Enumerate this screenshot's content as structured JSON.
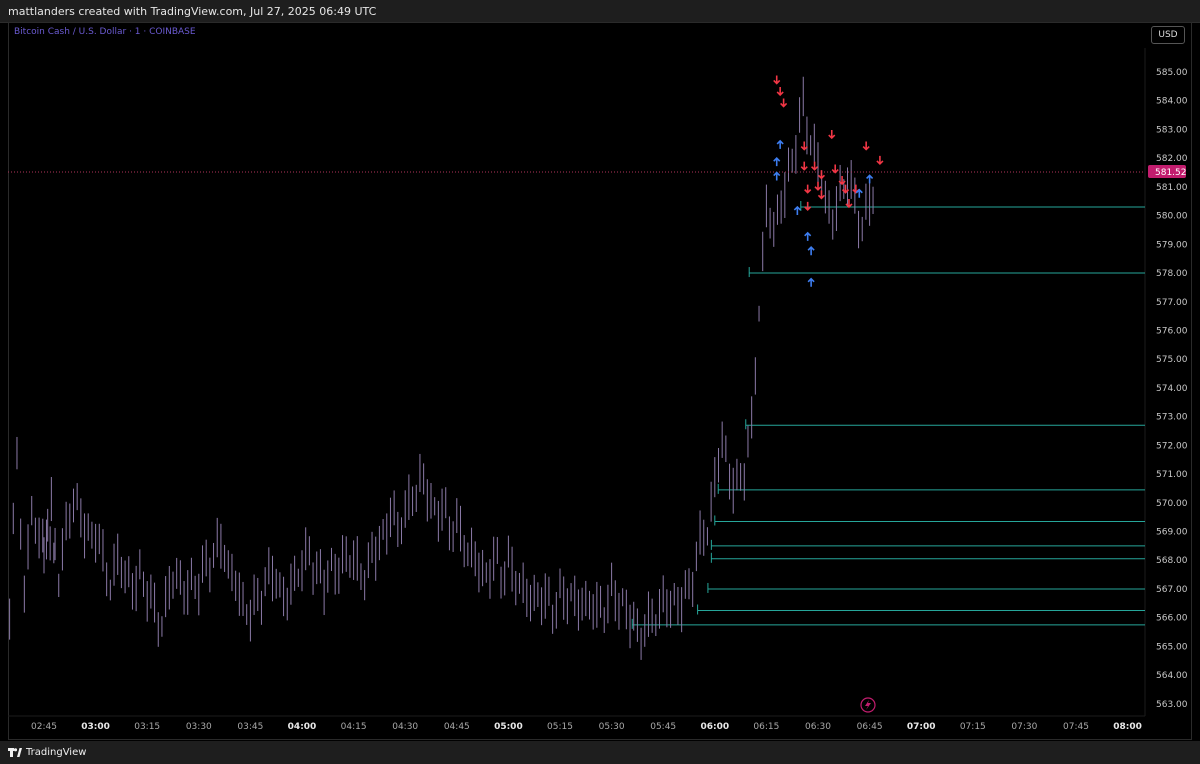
{
  "header": {
    "credit": "mattlanders created with TradingView.com, Jul 27, 2025 06:49 UTC"
  },
  "symbol": {
    "title": "Bitcoin Cash / U.S. Dollar · 1 · COINBASE"
  },
  "currency_button": {
    "label": "USD"
  },
  "footer": {
    "logo_text": "TradingView"
  },
  "colors": {
    "candle": "#8b7aa8",
    "level_line": "#26a69a",
    "up_arrow": "#3d7df0",
    "down_arrow": "#f23645",
    "last_price_line": "#b0355a",
    "last_price_badge": "#c21d6e"
  },
  "chart_data": {
    "type": "line",
    "ylim": [
      563,
      585.5
    ],
    "y_ticks": [
      "585.00",
      "584.00",
      "583.00",
      "582.00",
      "581.00",
      "580.00",
      "579.00",
      "578.00",
      "577.00",
      "576.00",
      "575.00",
      "574.00",
      "573.00",
      "572.00",
      "571.00",
      "570.00",
      "569.00",
      "568.00",
      "567.00",
      "566.00",
      "565.00",
      "564.00",
      "563.00"
    ],
    "x_ticks": [
      {
        "label": "02:45",
        "bold": false
      },
      {
        "label": "03:00",
        "bold": true
      },
      {
        "label": "03:15",
        "bold": false
      },
      {
        "label": "03:30",
        "bold": false
      },
      {
        "label": "03:45",
        "bold": false
      },
      {
        "label": "04:00",
        "bold": true
      },
      {
        "label": "04:15",
        "bold": false
      },
      {
        "label": "04:30",
        "bold": false
      },
      {
        "label": "04:45",
        "bold": false
      },
      {
        "label": "05:00",
        "bold": true
      },
      {
        "label": "05:15",
        "bold": false
      },
      {
        "label": "05:30",
        "bold": false
      },
      {
        "label": "05:45",
        "bold": false
      },
      {
        "label": "06:00",
        "bold": true
      },
      {
        "label": "06:15",
        "bold": false
      },
      {
        "label": "06:30",
        "bold": false
      },
      {
        "label": "06:45",
        "bold": false
      },
      {
        "label": "07:00",
        "bold": true
      },
      {
        "label": "07:15",
        "bold": false
      },
      {
        "label": "07:30",
        "bold": false
      },
      {
        "label": "07:45",
        "bold": false
      },
      {
        "label": "08:00",
        "bold": true
      }
    ],
    "last_price": {
      "value": 581.52,
      "label": "581.52"
    },
    "series": [
      {
        "time": "02:35",
        "values": [
          566.0,
          572.0,
          566.5,
          570.0,
          568.5,
          569.0,
          568.0
        ]
      },
      {
        "time": "02:45",
        "values": [
          568.5,
          569.8,
          567.5,
          569.0,
          570.2,
          569.5,
          568.8
        ]
      },
      {
        "time": "03:00",
        "values": [
          569.0,
          568.0,
          567.2,
          568.0,
          567.6,
          567.0,
          567.5
        ]
      },
      {
        "time": "03:15",
        "values": [
          567.0,
          566.2,
          565.8,
          567.0,
          567.6,
          566.8,
          567.2
        ]
      },
      {
        "time": "03:30",
        "values": [
          567.2,
          567.8,
          568.2,
          568.6,
          567.8,
          567.2,
          566.4
        ]
      },
      {
        "time": "03:45",
        "values": [
          566.2,
          566.6,
          567.2,
          567.6,
          567.0,
          566.6,
          567.4
        ]
      },
      {
        "time": "04:00",
        "values": [
          567.8,
          568.2,
          567.6,
          567.2,
          567.8,
          567.6,
          568.2
        ]
      },
      {
        "time": "04:15",
        "values": [
          568.0,
          567.4,
          567.8,
          568.4,
          568.8,
          569.6,
          569.2
        ]
      },
      {
        "time": "04:30",
        "values": [
          569.6,
          570.2,
          570.8,
          570.4,
          569.6,
          569.8,
          569.2
        ]
      },
      {
        "time": "04:45",
        "values": [
          569.2,
          568.6,
          568.2,
          567.8,
          567.4,
          568.0,
          567.6
        ]
      },
      {
        "time": "05:00",
        "values": [
          567.8,
          567.4,
          567.0,
          566.6,
          566.8,
          566.6,
          566.4
        ]
      },
      {
        "time": "05:15",
        "values": [
          566.6,
          566.8,
          566.6,
          566.4,
          566.6,
          566.2,
          566.4
        ]
      },
      {
        "time": "05:30",
        "values": [
          566.8,
          566.6,
          566.2,
          565.8,
          565.4,
          565.8,
          566.2
        ]
      },
      {
        "time": "05:45",
        "values": [
          566.4,
          566.6,
          566.4,
          566.8,
          567.4,
          568.6,
          569.2
        ]
      },
      {
        "time": "06:00",
        "values": [
          570.6,
          572.4,
          570.8,
          570.6,
          571.2,
          572.6,
          576.8
        ]
      },
      {
        "time": "06:15",
        "values": [
          580.2,
          579.6,
          580.4,
          581.4,
          582.6,
          583.8,
          582.6
        ]
      },
      {
        "time": "06:30",
        "values": [
          581.8,
          580.6,
          579.8,
          580.8,
          581.4,
          580.4,
          579.6
        ]
      },
      {
        "time": "06:45",
        "values": [
          580.6,
          580.8,
          581.2,
          581.6,
          581.5
        ]
      }
    ],
    "level_lines": [
      {
        "price": 580.3,
        "from": "06:25"
      },
      {
        "price": 578.0,
        "from": "06:10"
      },
      {
        "price": 572.7,
        "from": "06:09"
      },
      {
        "price": 570.45,
        "from": "06:01"
      },
      {
        "price": 569.35,
        "from": "06:00"
      },
      {
        "price": 568.5,
        "from": "05:59"
      },
      {
        "price": 568.05,
        "from": "05:59"
      },
      {
        "price": 567.0,
        "from": "05:58"
      },
      {
        "price": 566.25,
        "from": "05:55"
      },
      {
        "price": 565.75,
        "from": "05:36"
      }
    ],
    "signals": [
      {
        "time": "06:18",
        "price": 584.6,
        "dir": "down"
      },
      {
        "time": "06:19",
        "price": 584.2,
        "dir": "down"
      },
      {
        "time": "06:20",
        "price": 583.8,
        "dir": "down"
      },
      {
        "time": "06:19",
        "price": 582.6,
        "dir": "up"
      },
      {
        "time": "06:18",
        "price": 582.0,
        "dir": "up"
      },
      {
        "time": "06:18",
        "price": 581.5,
        "dir": "up"
      },
      {
        "time": "06:24",
        "price": 580.3,
        "dir": "up"
      },
      {
        "time": "06:26",
        "price": 582.3,
        "dir": "down"
      },
      {
        "time": "06:26",
        "price": 581.6,
        "dir": "down"
      },
      {
        "time": "06:27",
        "price": 580.8,
        "dir": "down"
      },
      {
        "time": "06:27",
        "price": 580.2,
        "dir": "down"
      },
      {
        "time": "06:27",
        "price": 579.4,
        "dir": "up"
      },
      {
        "time": "06:28",
        "price": 578.9,
        "dir": "up"
      },
      {
        "time": "06:29",
        "price": 581.6,
        "dir": "down"
      },
      {
        "time": "06:30",
        "price": 580.9,
        "dir": "down"
      },
      {
        "time": "06:31",
        "price": 581.3,
        "dir": "down"
      },
      {
        "time": "06:31",
        "price": 580.6,
        "dir": "down"
      },
      {
        "time": "06:28",
        "price": 577.8,
        "dir": "up"
      },
      {
        "time": "06:34",
        "price": 582.7,
        "dir": "down"
      },
      {
        "time": "06:35",
        "price": 581.5,
        "dir": "down"
      },
      {
        "time": "06:37",
        "price": 581.1,
        "dir": "down"
      },
      {
        "time": "06:38",
        "price": 580.8,
        "dir": "down"
      },
      {
        "time": "06:39",
        "price": 580.3,
        "dir": "down"
      },
      {
        "time": "06:41",
        "price": 580.8,
        "dir": "down"
      },
      {
        "time": "06:42",
        "price": 580.9,
        "dir": "up"
      },
      {
        "time": "06:44",
        "price": 582.3,
        "dir": "down"
      },
      {
        "time": "06:45",
        "price": 581.4,
        "dir": "up"
      },
      {
        "time": "06:48",
        "price": 581.8,
        "dir": "down"
      }
    ]
  }
}
